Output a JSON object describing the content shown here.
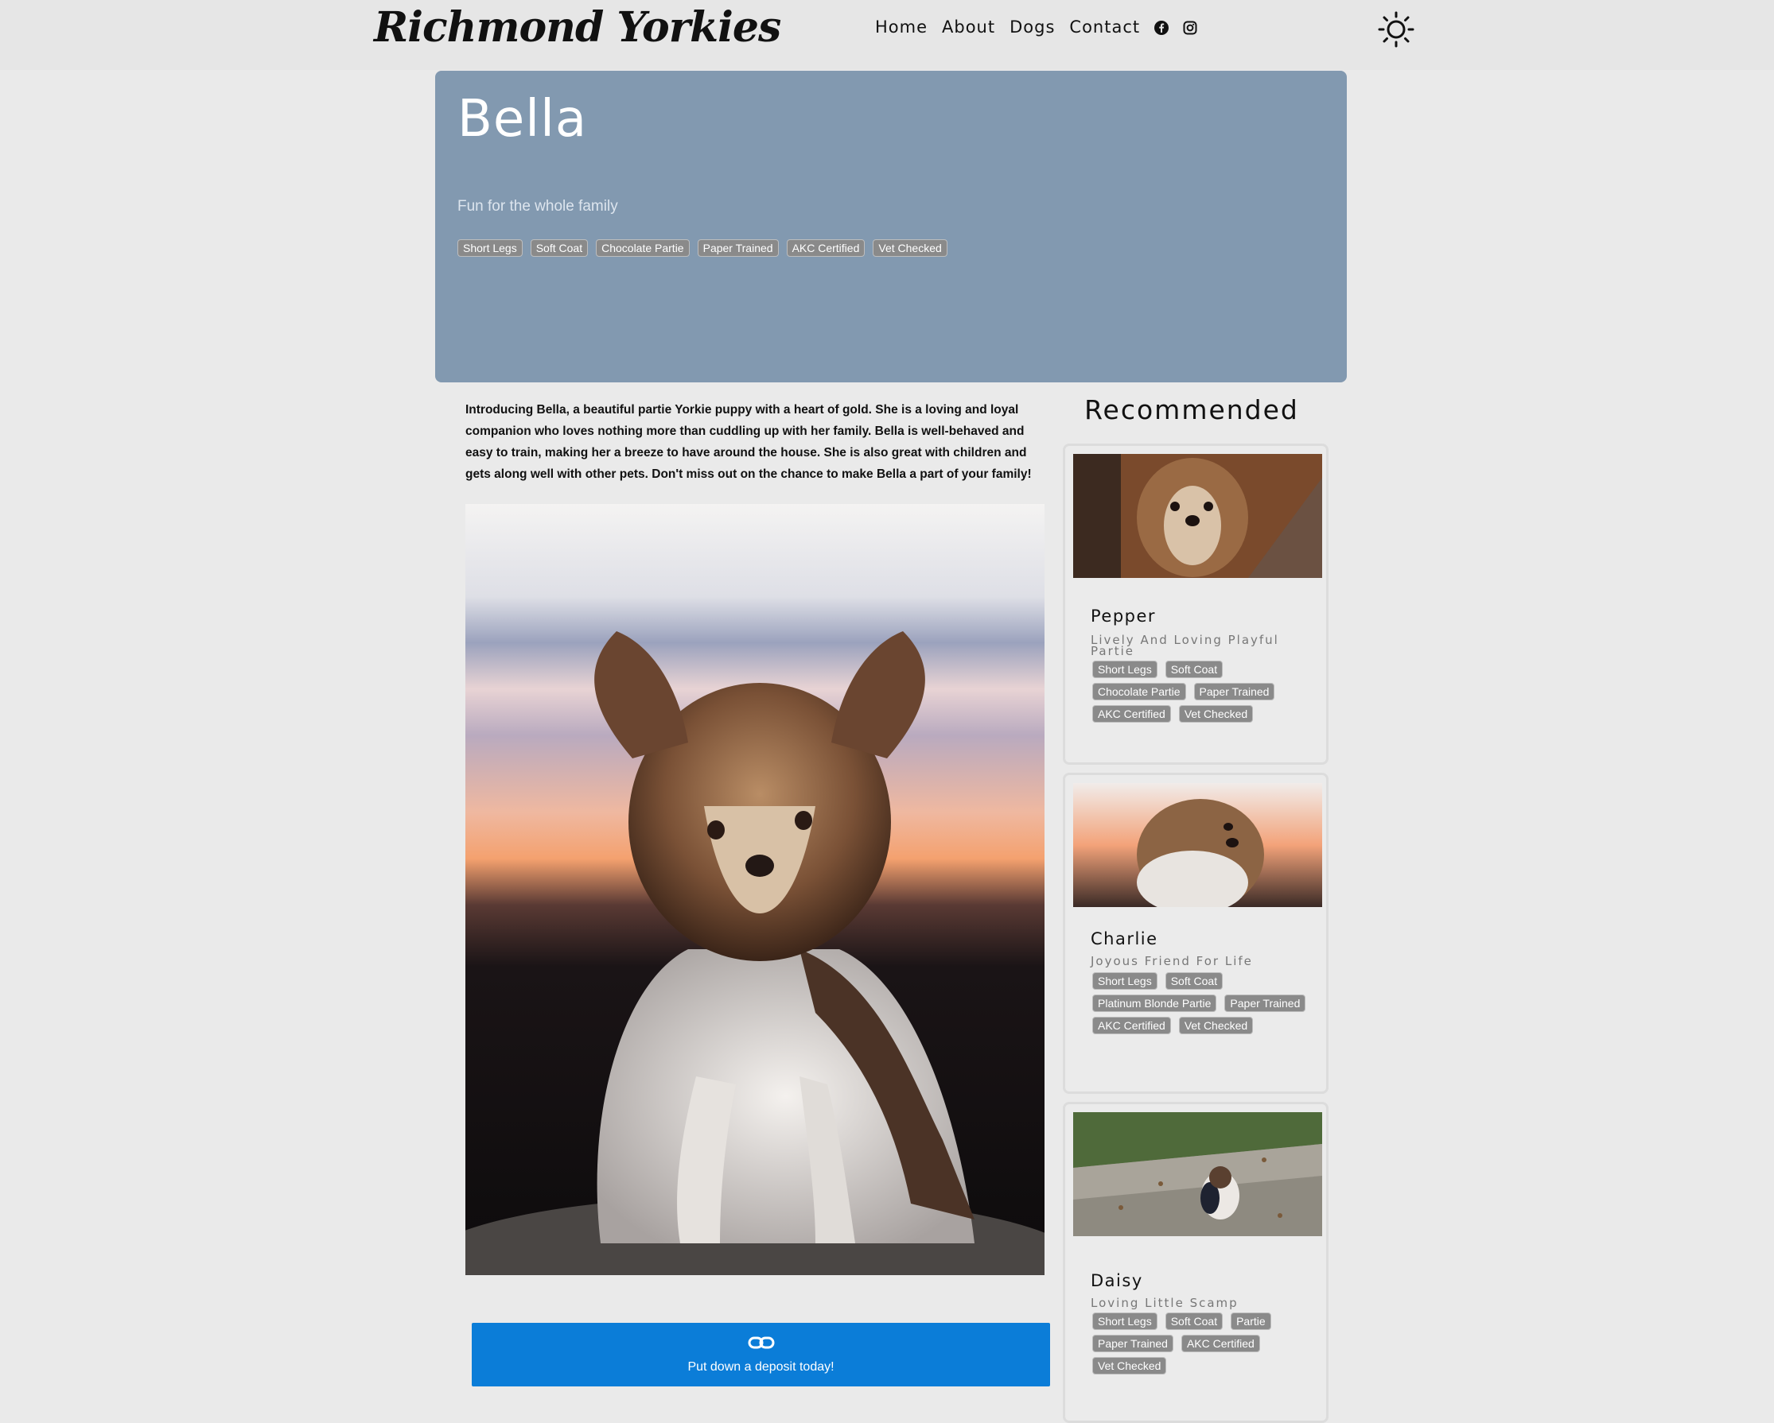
{
  "nav": {
    "brand": "Richmond Yorkies",
    "links": [
      "Home",
      "About",
      "Dogs",
      "Contact"
    ],
    "social_icons": [
      "facebook-icon",
      "instagram-icon"
    ],
    "theme_icon": "sun-icon"
  },
  "hero": {
    "title": "Bella",
    "subtitle": "Fun for the whole family",
    "tags": [
      "Short Legs",
      "Soft Coat",
      "Chocolate Partie",
      "Paper Trained",
      "AKC Certified",
      "Vet Checked"
    ],
    "background_color": "#8299b0"
  },
  "description": "Introducing Bella, a beautiful partie Yorkie puppy with a heart of gold. She is a loving and loyal companion who loves nothing more than cuddling up with her family. Bella is well-behaved and easy to train, making her a breeze to have around the house. She is also great with children and gets along well with other pets. Don't miss out on the chance to make Bella a part of your family!",
  "deposit": {
    "icon": "link-icon",
    "label": "Put down a deposit today!",
    "color": "#0b7dd8"
  },
  "recommended": {
    "title": "Recommended",
    "dogs": [
      {
        "name": "Pepper",
        "tagline": "Lively And Loving Playful Partie",
        "tags": [
          "Short Legs",
          "Soft Coat",
          "Chocolate Partie",
          "Paper Trained",
          "AKC Certified",
          "Vet Checked"
        ]
      },
      {
        "name": "Charlie",
        "tagline": "Joyous Friend For Life",
        "tags": [
          "Short Legs",
          "Soft Coat",
          "Platinum Blonde Partie",
          "Paper Trained",
          "AKC Certified",
          "Vet Checked"
        ]
      },
      {
        "name": "Daisy",
        "tagline": "Loving Little Scamp",
        "tags": [
          "Short Legs",
          "Soft Coat",
          "Partie",
          "Paper Trained",
          "AKC Certified",
          "Vet Checked"
        ]
      }
    ]
  }
}
